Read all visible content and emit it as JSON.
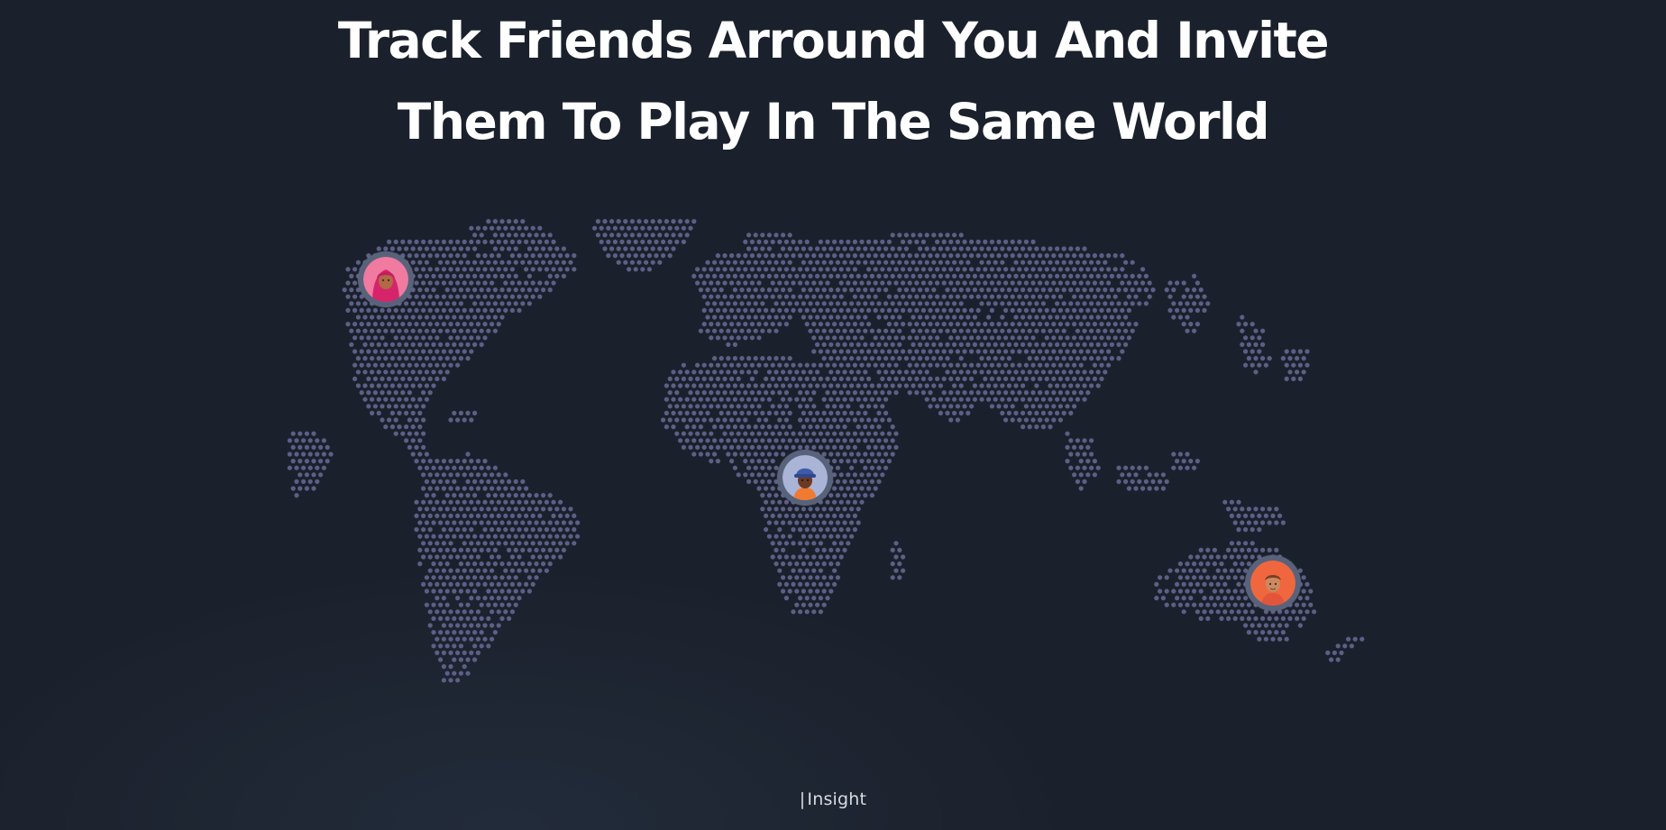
{
  "headline": {
    "line1": "Track Friends Arround You And Invite",
    "line2": "Them To Play In The Same World"
  },
  "map": {
    "dot_color": "#5d5f86",
    "icon": "world-dot-map"
  },
  "avatars": [
    {
      "name": "friend-avatar-north-america",
      "icon": "woman-hijab-avatar",
      "bg": "#f07aa0"
    },
    {
      "name": "friend-avatar-africa",
      "icon": "boy-cap-avatar",
      "bg": "#a9b4d6"
    },
    {
      "name": "friend-avatar-australia",
      "icon": "man-avatar",
      "bg": "#f0673f"
    }
  ],
  "footer": {
    "brand_bar": "|",
    "brand": "Insight"
  },
  "colors": {
    "background": "#1b212c",
    "text": "#ffffff",
    "avatar_ring": "#58637b"
  }
}
